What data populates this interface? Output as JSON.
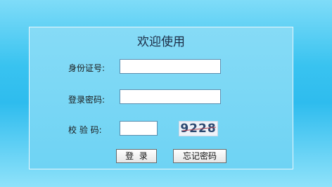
{
  "form": {
    "title": "欢迎使用",
    "id_label": "身份证号:",
    "id_value": "",
    "password_label": "登录密码:",
    "password_value": "",
    "captcha_label": "校 验 码:",
    "captcha_value": "",
    "captcha_image_text": "9228",
    "login_label": "登  录",
    "forgot_label": "忘记密码"
  }
}
